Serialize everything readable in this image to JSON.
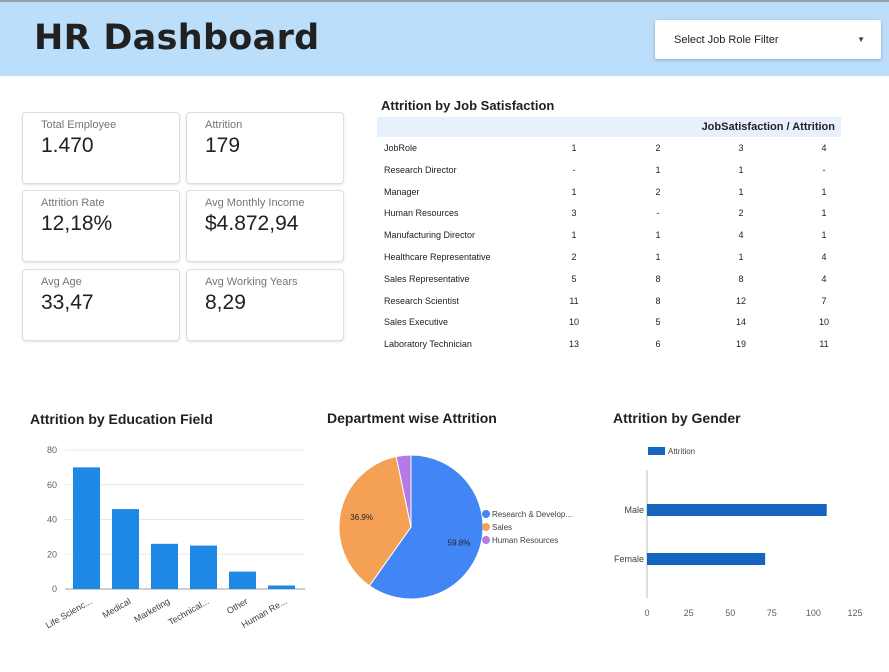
{
  "header": {
    "title": "HR Dashboard",
    "filter_label": "Select Job Role Filter"
  },
  "kpis": [
    {
      "label": "Total Employee",
      "value": "1.470"
    },
    {
      "label": "Attrition",
      "value": "179"
    },
    {
      "label": "Attrition Rate",
      "value": "12,18%"
    },
    {
      "label": "Avg Monthly Income",
      "value": "$4.872,94"
    },
    {
      "label": "Avg Age",
      "value": "33,47"
    },
    {
      "label": "Avg Working Years",
      "value": "8,29"
    }
  ],
  "satisfaction_table": {
    "title": "Attrition by Job Satisfaction",
    "header_label": "JobSatisfaction / Attrition",
    "columns": [
      "JobRole",
      "1",
      "2",
      "3",
      "4"
    ],
    "rows": [
      [
        "Research Director",
        "-",
        "1",
        "1",
        "-"
      ],
      [
        "Manager",
        "1",
        "2",
        "1",
        "1"
      ],
      [
        "Human Resources",
        "3",
        "-",
        "2",
        "1"
      ],
      [
        "Manufacturing Director",
        "1",
        "1",
        "4",
        "1"
      ],
      [
        "Healthcare Representative",
        "2",
        "1",
        "1",
        "4"
      ],
      [
        "Sales Representative",
        "5",
        "8",
        "8",
        "4"
      ],
      [
        "Research Scientist",
        "11",
        "8",
        "12",
        "7"
      ],
      [
        "Sales Executive",
        "10",
        "5",
        "14",
        "10"
      ],
      [
        "Laboratory Technician",
        "13",
        "6",
        "19",
        "11"
      ]
    ]
  },
  "colors": {
    "header_bg": "#bbdefb",
    "bar_blue": "#1e88e5",
    "pie_blue": "#4285f4",
    "pie_orange": "#f4a155",
    "pie_purple": "#b57ae6",
    "gender_blue": "#1565c0"
  },
  "icons": {
    "filter_caret": "caret-down-icon"
  },
  "chart_data": [
    {
      "type": "bar",
      "title": "Attrition by Education Field",
      "categories": [
        "Life Scienc...",
        "Medical",
        "Marketing",
        "Technical...",
        "Other",
        "Human Re..."
      ],
      "values": [
        70,
        46,
        26,
        25,
        10,
        2
      ],
      "ylim": [
        0,
        80
      ],
      "yticks": [
        0,
        20,
        40,
        60,
        80
      ],
      "grid": true
    },
    {
      "type": "pie",
      "title": "Department wise Attrition",
      "labels": [
        "Research & Develop...",
        "Sales",
        "Human Resources"
      ],
      "values": [
        59.8,
        36.9,
        3.3
      ],
      "value_labels": [
        "59.8%",
        "36.9%",
        ""
      ],
      "legend_position": "right"
    },
    {
      "type": "bar",
      "orientation": "horizontal",
      "title": "Attrition by Gender",
      "categories": [
        "Male",
        "Female"
      ],
      "series": [
        {
          "name": "Attrition",
          "values": [
            108,
            71
          ]
        }
      ],
      "xlim": [
        0,
        125
      ],
      "xticks": [
        0,
        25,
        50,
        75,
        100,
        125
      ],
      "legend_position": "top"
    }
  ]
}
